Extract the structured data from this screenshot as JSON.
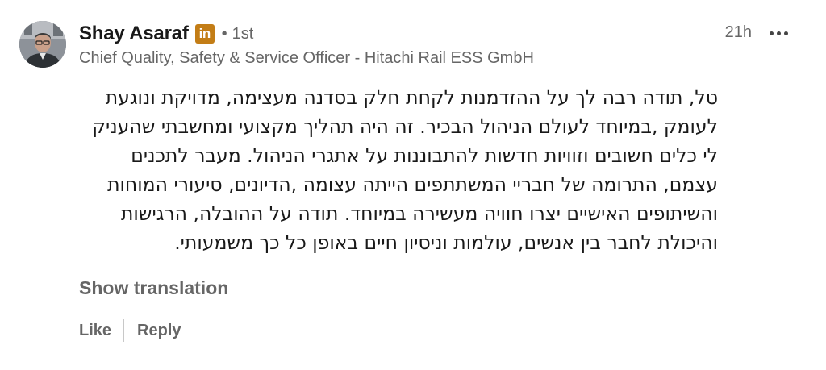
{
  "comment": {
    "author": {
      "name": "Shay Asaraf",
      "badge": "in",
      "separator": "•",
      "degree": "1st",
      "headline": "Chief Quality, Safety & Service Officer - Hitachi Rail ESS GmbH"
    },
    "timestamp": "21h",
    "more_icon": "ellipsis-icon",
    "body_lines": [
      "טל, תודה רבה לך על ההזדמנות לקחת חלק בסדנה מעצימה, מדויקת ונוגעת",
      "לעומק ,במיוחד לעולם הניהול הבכיר. זה היה תהליך מקצועי ומחשבתי שהעניק",
      "לי כלים חשובים וזוויות חדשות להתבוננות על אתגרי הניהול. מעבר לתכנים",
      "עצמם, התרומה של חבריי המשתתפים הייתה עצומה ,הדיונים, סיעורי המוחות",
      "והשיתופים האישיים יצרו חוויה מעשירה במיוחד. תודה על ההובלה, הרגישות",
      "והיכולת לחבר בין אנשים, עולמות וניסיון חיים באופן כל כך משמעותי."
    ],
    "show_translation_label": "Show translation",
    "actions": {
      "like_label": "Like",
      "reply_label": "Reply"
    }
  },
  "colors": {
    "primary_text": "#191919",
    "secondary_text": "#666666",
    "badge": "#c37d16",
    "divider": "#c8c8c8"
  }
}
